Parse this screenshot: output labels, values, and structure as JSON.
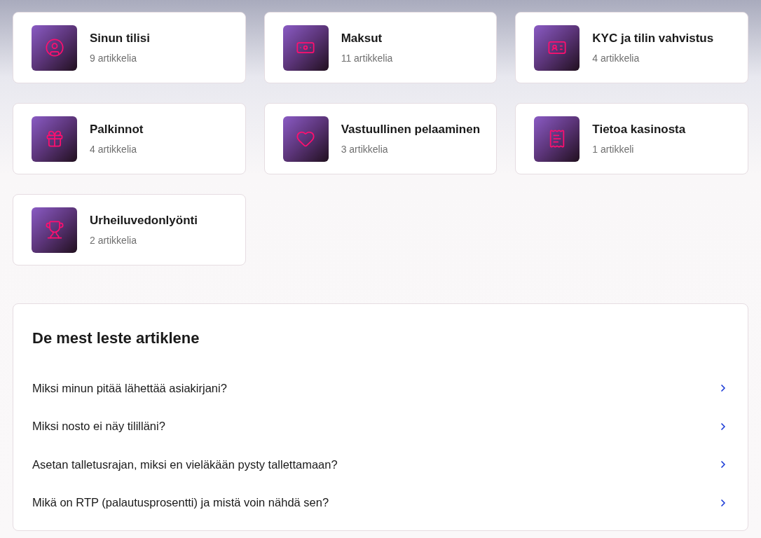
{
  "categories": [
    {
      "title": "Sinun tilisi",
      "count": "9 artikkelia"
    },
    {
      "title": "Maksut",
      "count": "11 artikkelia"
    },
    {
      "title": "KYC ja tilin vahvistus",
      "count": "4 artikkelia"
    },
    {
      "title": "Palkinnot",
      "count": "4 artikkelia"
    },
    {
      "title": "Vastuullinen pelaaminen",
      "count": "3 artikkelia"
    },
    {
      "title": "Tietoa kasinosta",
      "count": "1 artikkeli"
    },
    {
      "title": "Urheiluvedonlyönti",
      "count": "2 artikkelia"
    }
  ],
  "popular": {
    "title": "De mest leste artiklene",
    "articles": [
      "Miksi minun pitää lähettää asiakirjani?",
      "Miksi nosto ei näy tililläni?",
      "Asetan talletusrajan, miksi en vieläkään pysty tallettamaan?",
      "Mikä on RTP (palautusprosentti) ja mistä voin nähdä sen?"
    ]
  }
}
